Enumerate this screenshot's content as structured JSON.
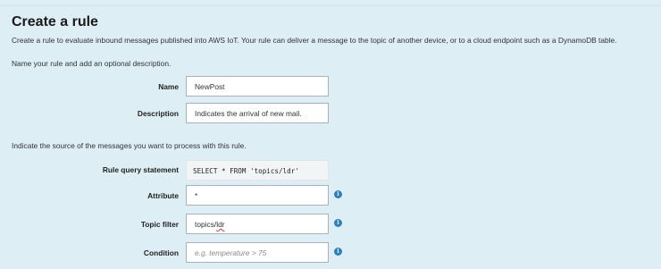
{
  "page": {
    "title": "Create a rule",
    "intro": "Create a rule to evaluate inbound messages published into AWS IoT. Your rule can deliver a message to the topic of another device, or to a cloud endpoint such as a DynamoDB table.",
    "name_section": "Name your rule and add an optional description.",
    "source_section": "Indicate the source of the messages you want to process with this rule."
  },
  "form": {
    "name": {
      "label": "Name",
      "value": "NewPost"
    },
    "description": {
      "label": "Description",
      "value": "Indicates the arrival of new mail."
    },
    "query": {
      "label": "Rule query statement",
      "value": "SELECT * FROM 'topics/ldr'"
    },
    "attribute": {
      "label": "Attribute",
      "value": "*",
      "info_icon": "i"
    },
    "topic_filter": {
      "label": "Topic filter",
      "value_prefix": "topics/",
      "value_flagged": "ldr",
      "info_icon": "i"
    },
    "condition": {
      "label": "Condition",
      "placeholder": "e.g. temperature > 75",
      "info_icon": "i"
    }
  },
  "colors": {
    "background": "#ddeef5",
    "info_accent": "#2a7fc1"
  }
}
